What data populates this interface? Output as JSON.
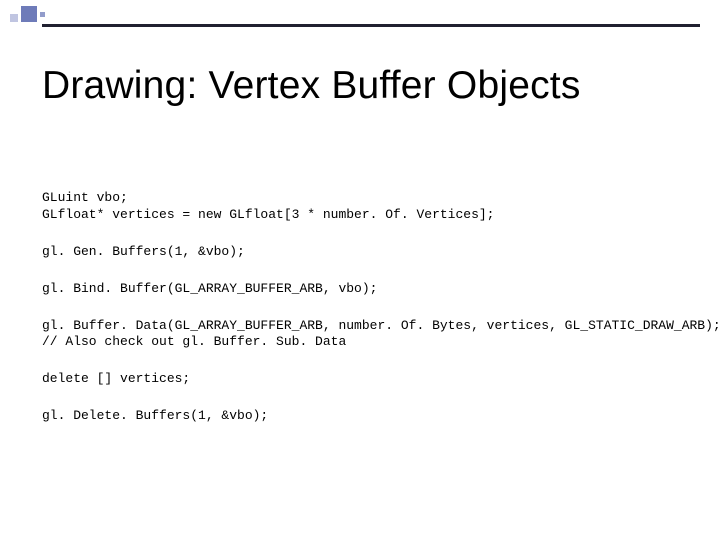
{
  "slide": {
    "title": "Drawing:  Vertex Buffer Objects",
    "code": {
      "line1": "GLuint vbo;",
      "line2": "GLfloat* vertices = new GLfloat[3 * number. Of. Vertices];",
      "line3": "gl. Gen. Buffers(1, &vbo);",
      "line4": "gl. Bind. Buffer(GL_ARRAY_BUFFER_ARB, vbo);",
      "line5": "gl. Buffer. Data(GL_ARRAY_BUFFER_ARB, number. Of. Bytes, vertices, GL_STATIC_DRAW_ARB);",
      "line6": "// Also check out gl. Buffer. Sub. Data",
      "line7": "delete [] vertices;",
      "line8": "gl. Delete. Buffers(1, &vbo);"
    }
  }
}
